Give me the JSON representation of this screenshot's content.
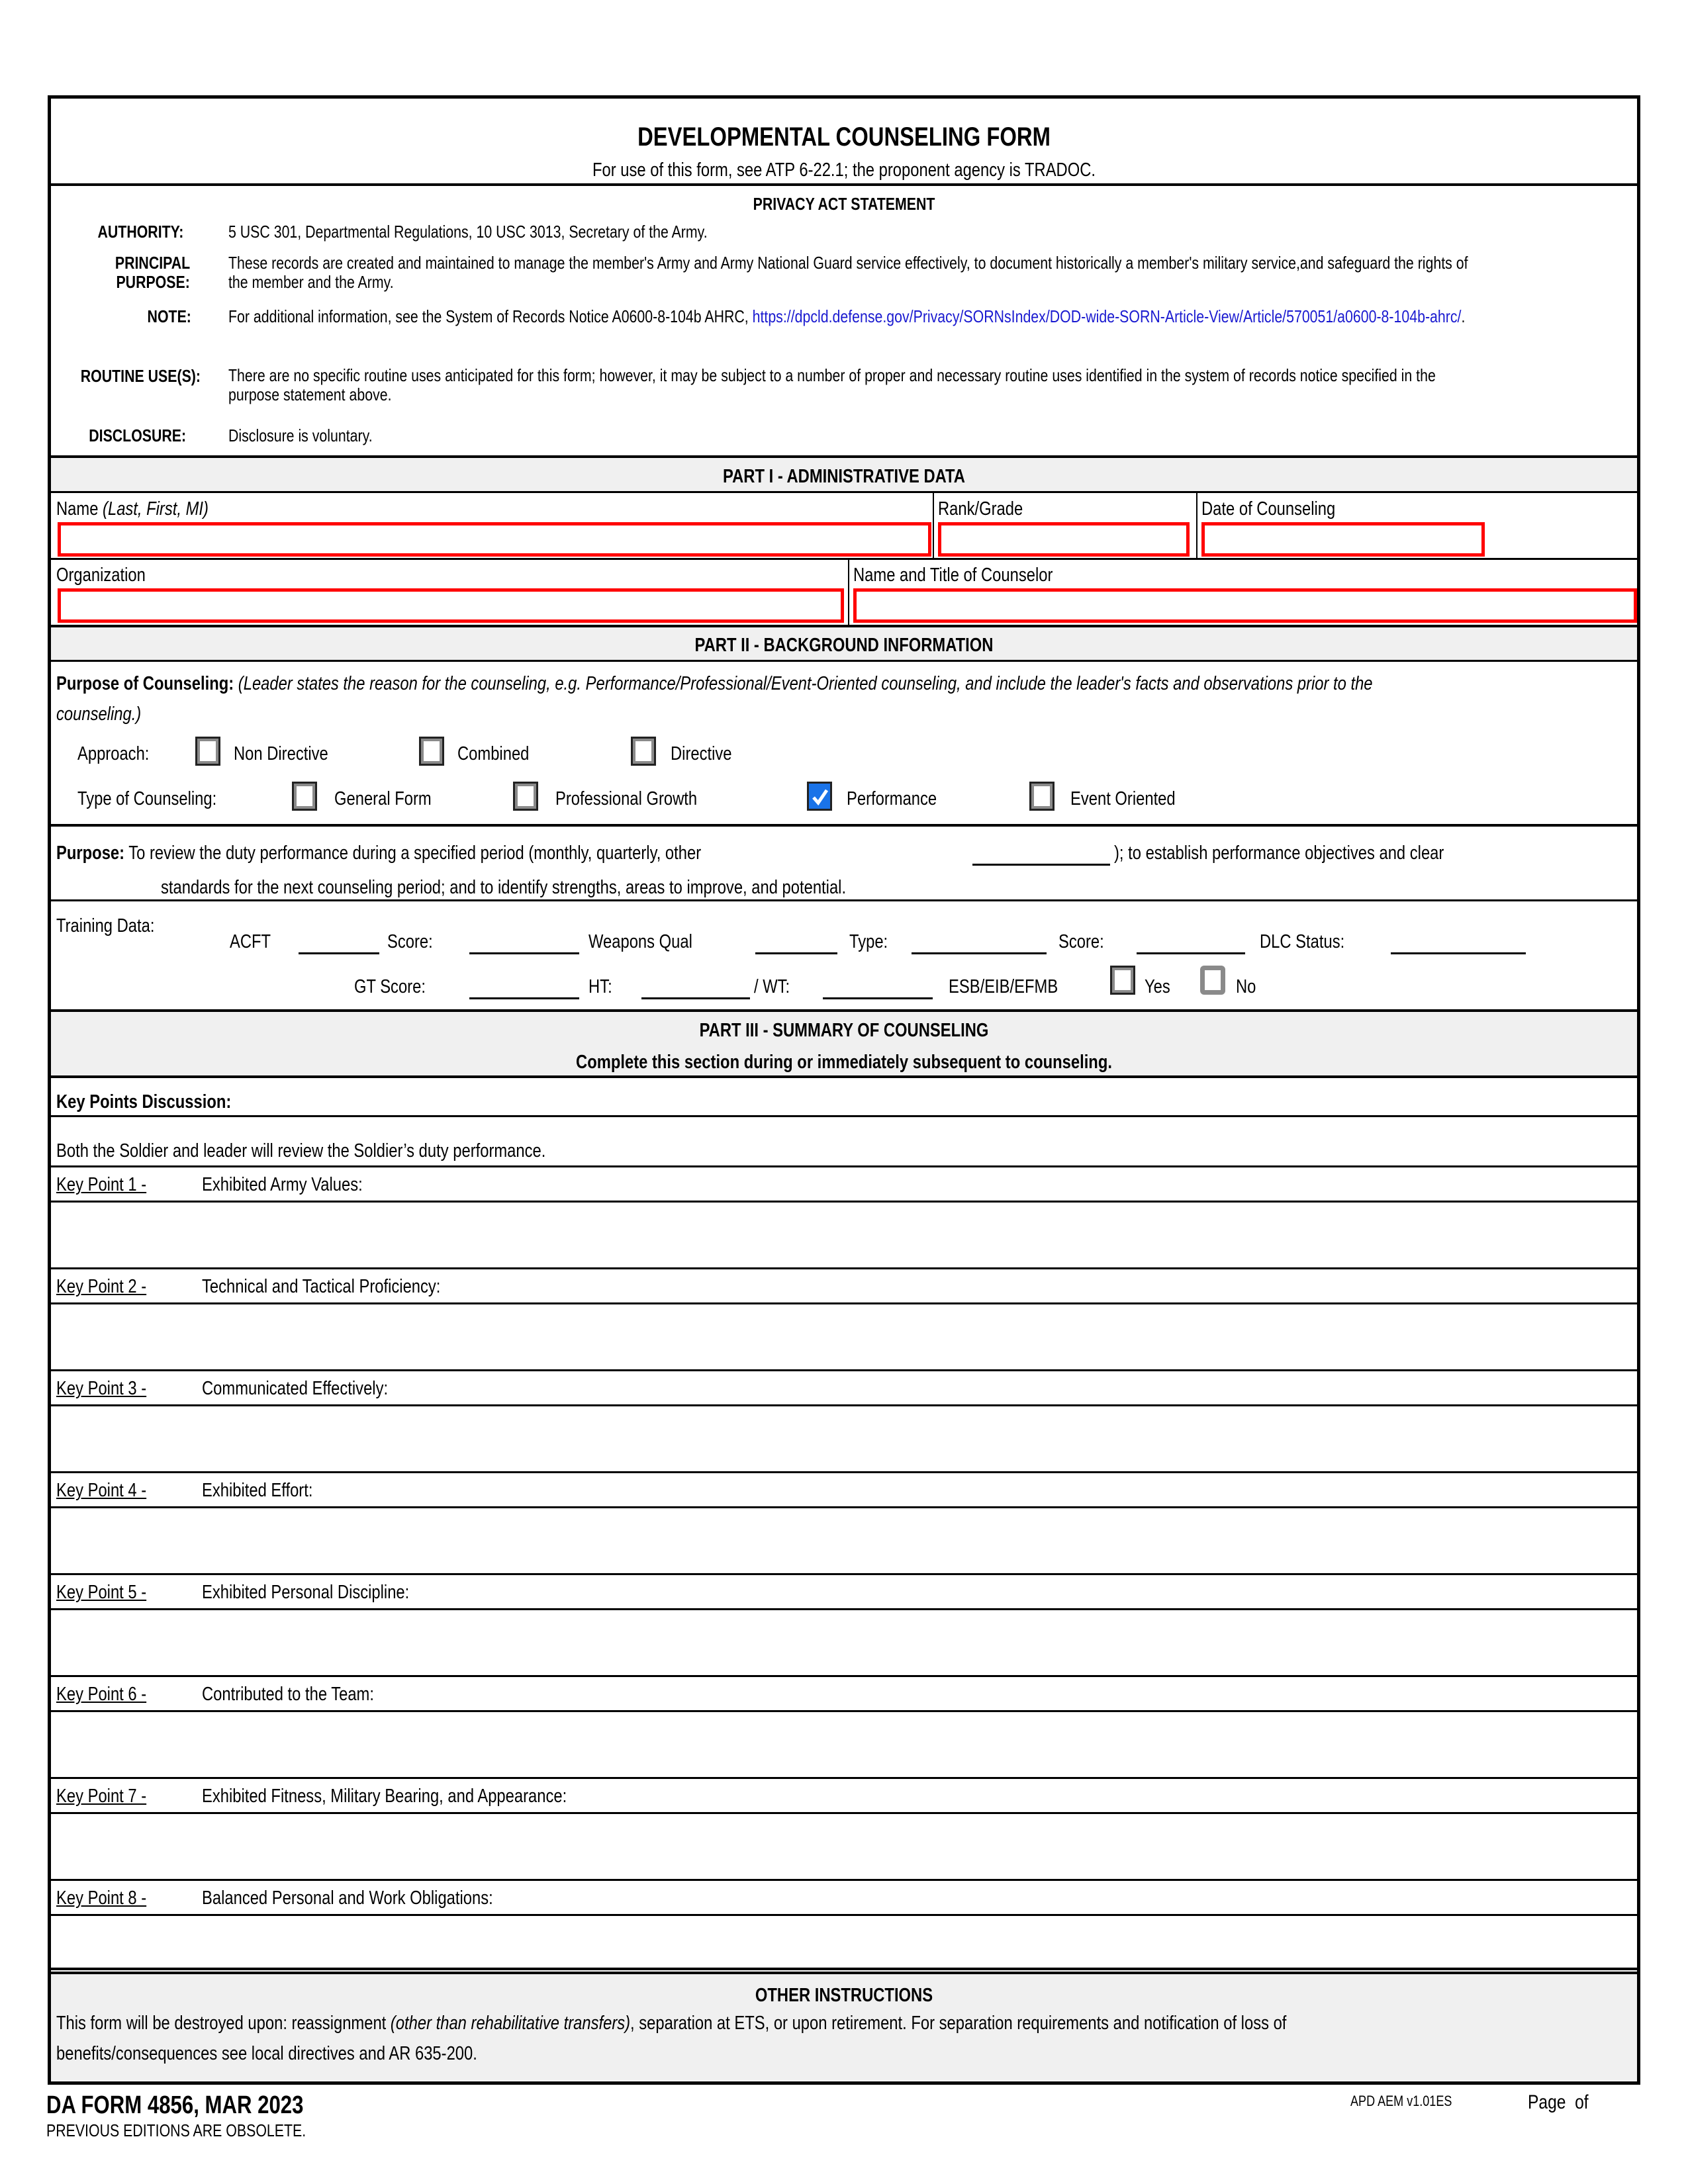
{
  "header": {
    "title": "DEVELOPMENTAL COUNSELING FORM",
    "subtitle": "For use of this form, see ATP 6-22.1; the proponent agency is TRADOC."
  },
  "privacy": {
    "heading": "PRIVACY ACT STATEMENT",
    "authority_label": "AUTHORITY:",
    "authority_text": "5 USC 301, Departmental Regulations, 10 USC 3013, Secretary of the Army.",
    "purpose_label_1": "PRINCIPAL",
    "purpose_label_2": "PURPOSE:",
    "purpose_text_1": "These records are created and maintained to manage the member's Army and Army National Guard service effectively, to document historically a member's military service,and safeguard the rights of",
    "purpose_text_2": "the member and the Army.",
    "note_label": "NOTE:",
    "note_text": "For additional information, see the System of Records Notice A0600-8-104b AHRC, ",
    "note_link": "https://dpcld.defense.gov/Privacy/SORNsIndex/DOD-wide-SORN-Article-View/Article/570051/a0600-8-104b-ahrc/",
    "note_end": ".",
    "routine_label": "ROUTINE USE(S):",
    "routine_text_1": "There are no specific routine uses anticipated for this form; however, it may be subject to a number of proper and necessary routine uses identified in the system of records notice specified in the",
    "routine_text_2": "purpose statement above.",
    "disclosure_label": "DISCLOSURE:",
    "disclosure_text": "Disclosure is voluntary."
  },
  "part1": {
    "heading": "PART I - ADMINISTRATIVE DATA",
    "name_label": "Name ",
    "name_hint": "(Last, First, MI)",
    "name_value": "",
    "rank_label": "Rank/Grade",
    "rank_value": "",
    "date_label": "Date of Counseling",
    "date_value": "",
    "org_label": "Organization",
    "org_value": "",
    "counselor_label": "Name and Title of Counselor",
    "counselor_value": ""
  },
  "part2": {
    "heading": "PART II - BACKGROUND INFORMATION",
    "purpose_label": "Purpose of Counseling:",
    "purpose_hint_1": " (Leader states the reason for the counseling, e.g. Performance/Professional/Event-Oriented counseling, and include the leader's facts and observations prior to the",
    "purpose_hint_2": "counseling.)",
    "approach_label": "Approach:",
    "approach_options": [
      {
        "label": "Non Directive",
        "checked": false
      },
      {
        "label": "Combined",
        "checked": false
      },
      {
        "label": "Directive",
        "checked": false
      }
    ],
    "type_label": "Type of Counseling:",
    "type_options": [
      {
        "label": "General Form",
        "checked": false
      },
      {
        "label": "Professional Growth",
        "checked": false
      },
      {
        "label": "Performance",
        "checked": true
      },
      {
        "label": "Event Oriented",
        "checked": false
      }
    ],
    "statement_label": "Purpose:",
    "statement_1": " To review the duty performance during a specified period (monthly, quarterly, other",
    "statement_2": "); to establish performance objectives and clear",
    "statement_3": "standards for the next counseling period; and to identify strengths, areas to improve, and potential.",
    "other_period_value": "",
    "training": {
      "label": "Training Data:",
      "acft_label": "ACFT",
      "acft_value": "",
      "acft_score_label": "Score:",
      "acft_score_value": "",
      "weapons_label": "Weapons Qual",
      "weapons_value": "",
      "type_label": "Type:",
      "type_value": "",
      "weapons_score_label": "Score:",
      "weapons_score_value": "",
      "dlc_label": "DLC Status:",
      "dlc_value": "",
      "gt_label": "GT Score:",
      "gt_value": "",
      "ht_label": "HT:",
      "ht_value": "",
      "wt_label": "/ WT:",
      "wt_value": "",
      "esb_label": "ESB/EIB/EFMB",
      "yes_label": "Yes",
      "yes_checked": false,
      "no_label": "No",
      "no_checked": false
    }
  },
  "part3": {
    "heading": "PART III - SUMMARY OF COUNSELING",
    "subheading": "Complete this section during or immediately subsequent to counseling.",
    "key_points_label": "Key Points Discussion:",
    "intro": "Both the Soldier and leader will review the Soldier’s duty performance.",
    "key_points": [
      {
        "num": "Key Point 1 -",
        "title": "Exhibited Army Values:",
        "value": ""
      },
      {
        "num": "Key Point 2 -",
        "title": "Technical and Tactical Proficiency:",
        "value": ""
      },
      {
        "num": "Key Point 3 -",
        "title": "Communicated Effectively:",
        "value": ""
      },
      {
        "num": "Key Point 4 -",
        "title": "Exhibited Effort:",
        "value": ""
      },
      {
        "num": "Key Point 5 -",
        "title": "Exhibited Personal Discipline:",
        "value": ""
      },
      {
        "num": "Key Point 6 -",
        "title": "Contributed to the Team:",
        "value": ""
      },
      {
        "num": "Key Point 7 -",
        "title": "Exhibited Fitness, Military Bearing, and Appearance:",
        "value": ""
      },
      {
        "num": "Key Point 8 -",
        "title": "Balanced Personal and Work Obligations:",
        "value": ""
      }
    ]
  },
  "other": {
    "heading": "OTHER INSTRUCTIONS",
    "text_1a": "This form will be destroyed upon: reassignment ",
    "text_1b": "(other than rehabilitative transfers)",
    "text_1c": ", separation at ETS, or upon retirement. For separation requirements and notification of loss of",
    "text_2": "benefits/consequences see local directives and AR 635-200."
  },
  "footer": {
    "form_id": "DA FORM 4856, MAR 2023",
    "obsolete": "PREVIOUS EDITIONS ARE OBSOLETE.",
    "version": "APD AEM v1.01ES",
    "page_label": "Page  of"
  },
  "colors": {
    "required_border": "#ff0000",
    "checked_fill": "#1a73e8",
    "section_gray": "#f0f0f0",
    "link": "#1a1ad0"
  }
}
